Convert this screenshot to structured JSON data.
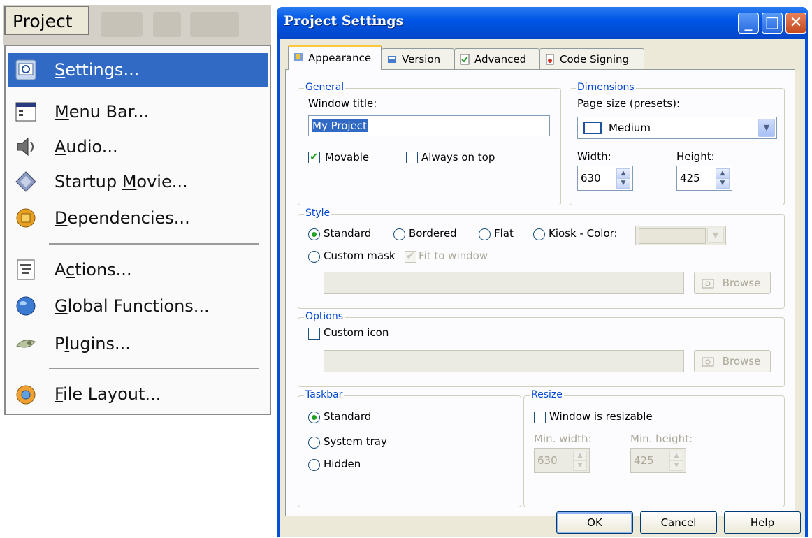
{
  "menu": {
    "title": "Project",
    "items": [
      {
        "label_pre": "",
        "label_key": "S",
        "label_post": "ettings...",
        "icon": "settings-icon",
        "selected": true
      },
      {
        "label_pre": "",
        "label_key": "M",
        "label_post": "enu Bar...",
        "icon": "menu-bar-icon"
      },
      {
        "label_pre": "",
        "label_key": "A",
        "label_post": "udio...",
        "icon": "audio-icon"
      },
      {
        "label_pre": "Startup ",
        "label_key": "M",
        "label_post": "ovie...",
        "icon": "startup-movie-icon"
      },
      {
        "label_pre": "",
        "label_key": "D",
        "label_post": "ependencies...",
        "icon": "dependencies-icon"
      },
      {
        "label_pre": "A",
        "label_key": "c",
        "label_post": "tions...",
        "icon": "actions-icon"
      },
      {
        "label_pre": "",
        "label_key": "G",
        "label_post": "lobal Functions...",
        "icon": "global-functions-icon"
      },
      {
        "label_pre": "P",
        "label_key": "l",
        "label_post": "ugins...",
        "icon": "plugins-icon"
      },
      {
        "label_pre": "",
        "label_key": "F",
        "label_post": "ile Layout...",
        "icon": "file-layout-icon"
      }
    ]
  },
  "dialog": {
    "title": "Project Settings",
    "tabs": [
      {
        "label": "Appearance",
        "icon": "appearance-icon",
        "active": true
      },
      {
        "label": "Version",
        "icon": "version-icon"
      },
      {
        "label": "Advanced",
        "icon": "advanced-icon"
      },
      {
        "label": "Code Signing",
        "icon": "code-signing-icon"
      }
    ],
    "general": {
      "legend": "General",
      "window_title_label": "Window title:",
      "window_title_value": "My Project",
      "movable_label": "Movable",
      "movable_checked": true,
      "always_on_top_label": "Always on top",
      "always_on_top_checked": false
    },
    "dimensions": {
      "legend": "Dimensions",
      "page_size_label": "Page size (presets):",
      "page_size_value": "Medium",
      "width_label": "Width:",
      "width_value": "630",
      "height_label": "Height:",
      "height_value": "425"
    },
    "style": {
      "legend": "Style",
      "standard": "Standard",
      "bordered": "Bordered",
      "flat": "Flat",
      "kiosk": "Kiosk - Color:",
      "custom_mask": "Custom mask",
      "fit_to_window": "Fit to window",
      "browse": "Browse",
      "selected": "Standard"
    },
    "options": {
      "legend": "Options",
      "custom_icon": "Custom icon",
      "browse": "Browse"
    },
    "taskbar": {
      "legend": "Taskbar",
      "standard": "Standard",
      "system_tray": "System tray",
      "hidden": "Hidden",
      "selected": "Standard"
    },
    "resize": {
      "legend": "Resize",
      "resizable_label": "Window is resizable",
      "min_width_label": "Min. width:",
      "min_width_value": "630",
      "min_height_label": "Min. height:",
      "min_height_value": "425"
    },
    "buttons": {
      "ok": "OK",
      "cancel": "Cancel",
      "help": "Help"
    }
  }
}
